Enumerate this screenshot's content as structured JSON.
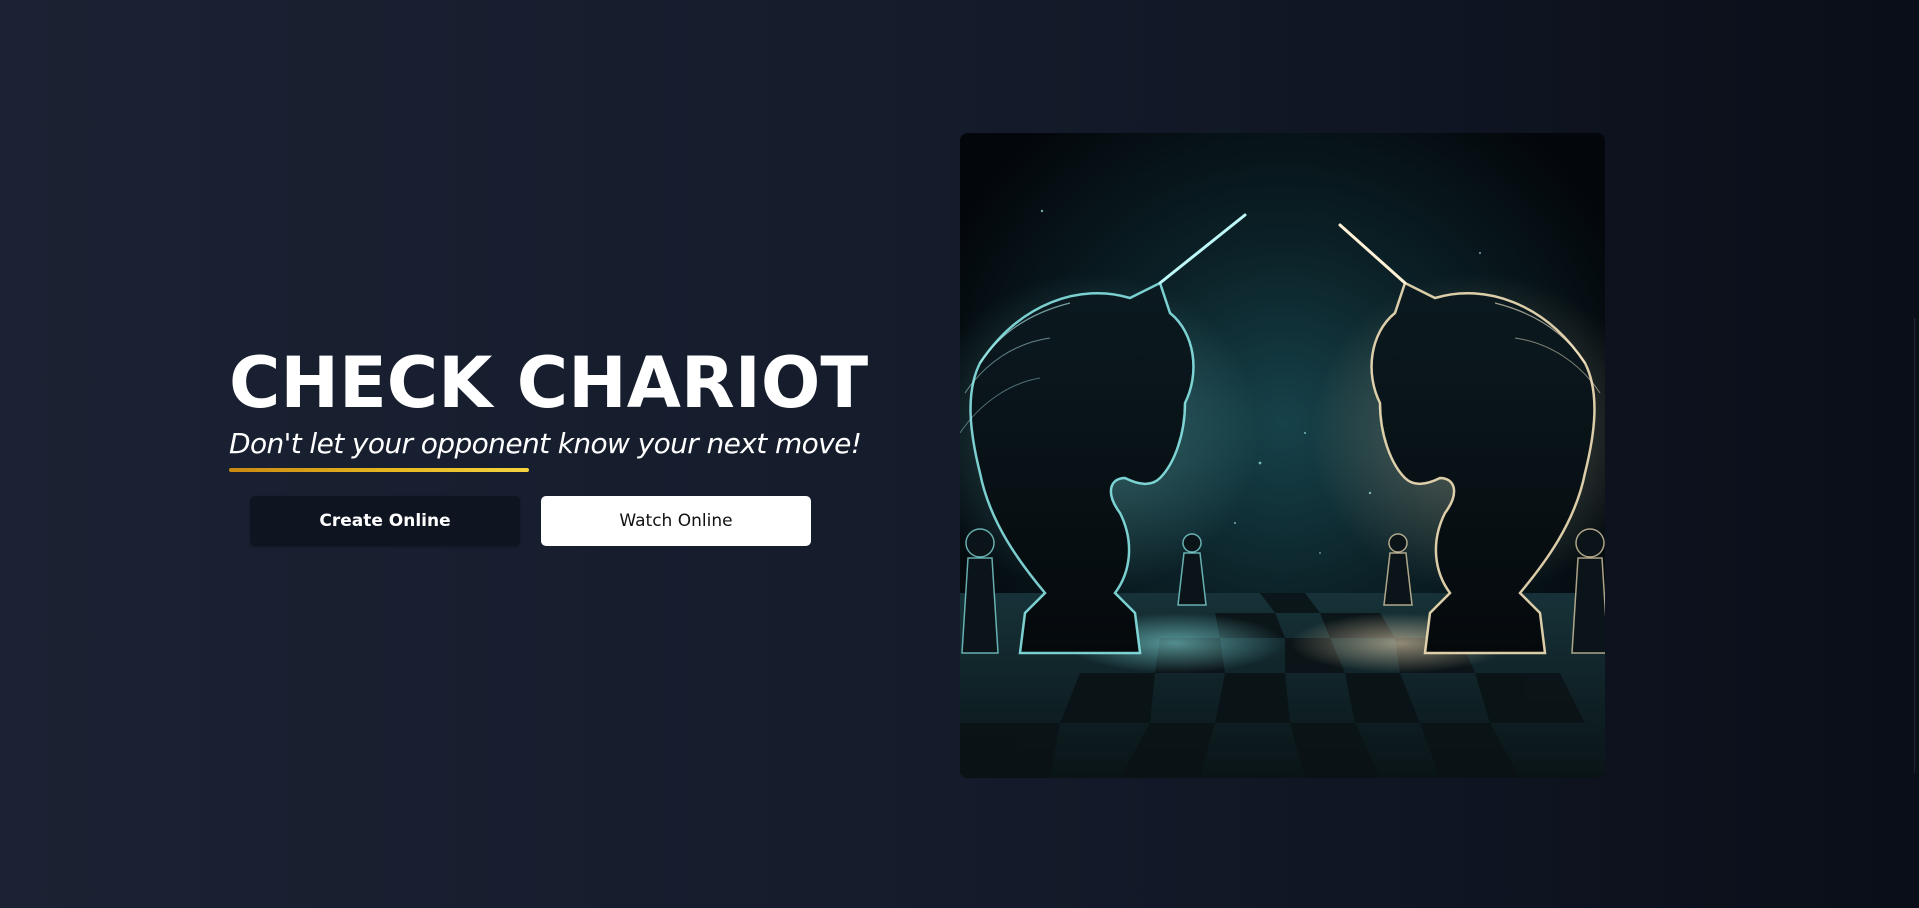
{
  "hero": {
    "title": "CHECK CHARIOT",
    "tagline": "Don't let your opponent know your next move!",
    "buttons": {
      "create_label": "Create Online",
      "watch_label": "Watch Online"
    }
  },
  "colors": {
    "accent_underline_start": "#c98a12",
    "accent_underline_end": "#f4d440",
    "glow_left": "#7fe0e0",
    "glow_right": "#f3e1b8"
  },
  "image": {
    "subject": "two-glowing-unicorn-chess-knights-facing-each-other-on-chessboard"
  }
}
